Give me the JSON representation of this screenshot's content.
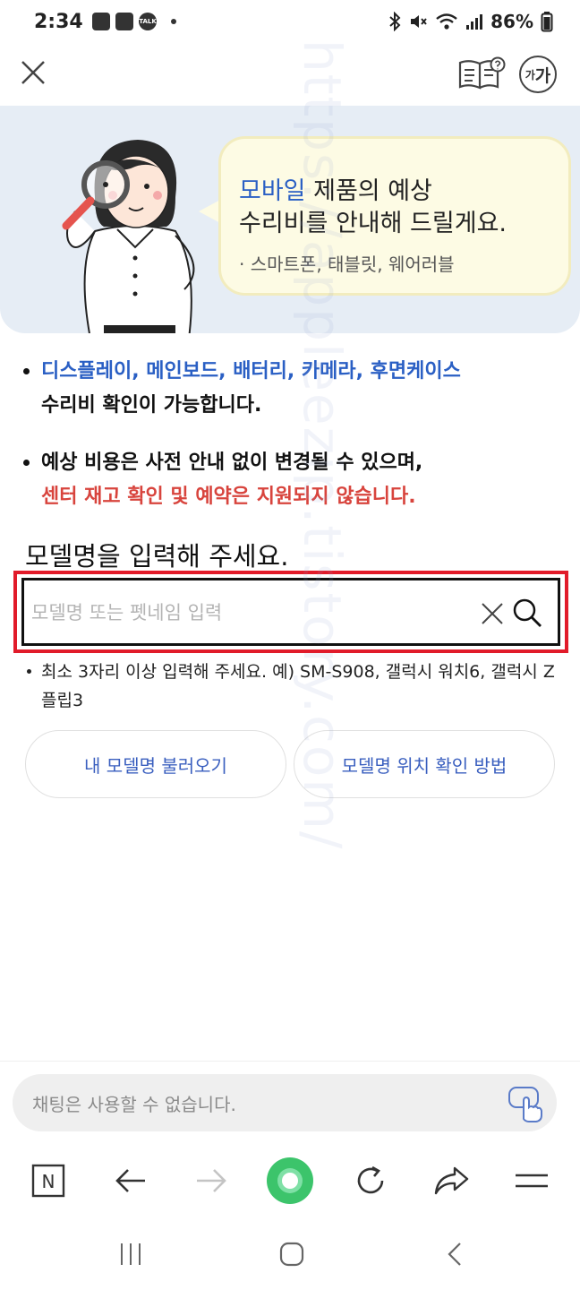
{
  "status_bar": {
    "time": "2:34",
    "battery": "86%",
    "left_icons": [
      "photo-icon",
      "screen-icon",
      "talk-icon"
    ],
    "talk_badge": "TALK",
    "right_icons": [
      "bluetooth-icon",
      "mute-icon",
      "wifi-icon",
      "signal-icon",
      "battery-icon"
    ]
  },
  "top_bar": {
    "icons": [
      "close-icon",
      "guide-book-icon",
      "font-size-icon"
    ],
    "font_button_label_small": "가",
    "font_button_label_big": "가"
  },
  "hero": {
    "line1_accent": "모바일",
    "line1_rest": " 제품의 예상",
    "line2": "수리비를 안내해 드릴게요.",
    "sub": "· 스마트폰, 태블릿, 웨어러블"
  },
  "notices": {
    "n1_blue": "디스플레이, 메인보드, 배터리, 카메라, 후면케이스",
    "n1_dark": "수리비 확인이 가능합니다.",
    "n2_dark": "예상 비용은 사전 안내 없이 변경될 수 있으며,",
    "n2_red": "센터 재고 확인 및 예약은 지원되지 않습니다."
  },
  "model_search": {
    "heading": "모델명을 입력해 주세요.",
    "placeholder": "모델명 또는 펫네임 입력",
    "value": "",
    "hint": "최소 3자리 이상 입력해 주세요. 예) SM-S908, 갤럭시 워치6, 갤럭시 Z플립3"
  },
  "buttons": {
    "load_model": "내 모델명 불러오기",
    "model_location": "모델명 위치 확인 방법"
  },
  "chat": {
    "placeholder": "채팅은 사용할 수 없습니다."
  },
  "browser_nav": {
    "icons": [
      "naver-n-icon",
      "back-arrow-icon",
      "forward-arrow-icon",
      "home-circle-icon",
      "refresh-icon",
      "share-icon",
      "menu-icon"
    ],
    "naver_letter": "N"
  },
  "system_nav": {
    "icons": [
      "recent-apps-icon",
      "home-icon",
      "back-icon"
    ]
  },
  "watermark": "https://appleezip.tistory.com/",
  "colors": {
    "accent_blue": "#2a5fc4",
    "warning_red": "#d8443d",
    "highlight_red": "#e11b2a",
    "hero_bg": "#e6edf5",
    "bubble_bg": "#fdfbe4",
    "green": "#3cc46b"
  }
}
